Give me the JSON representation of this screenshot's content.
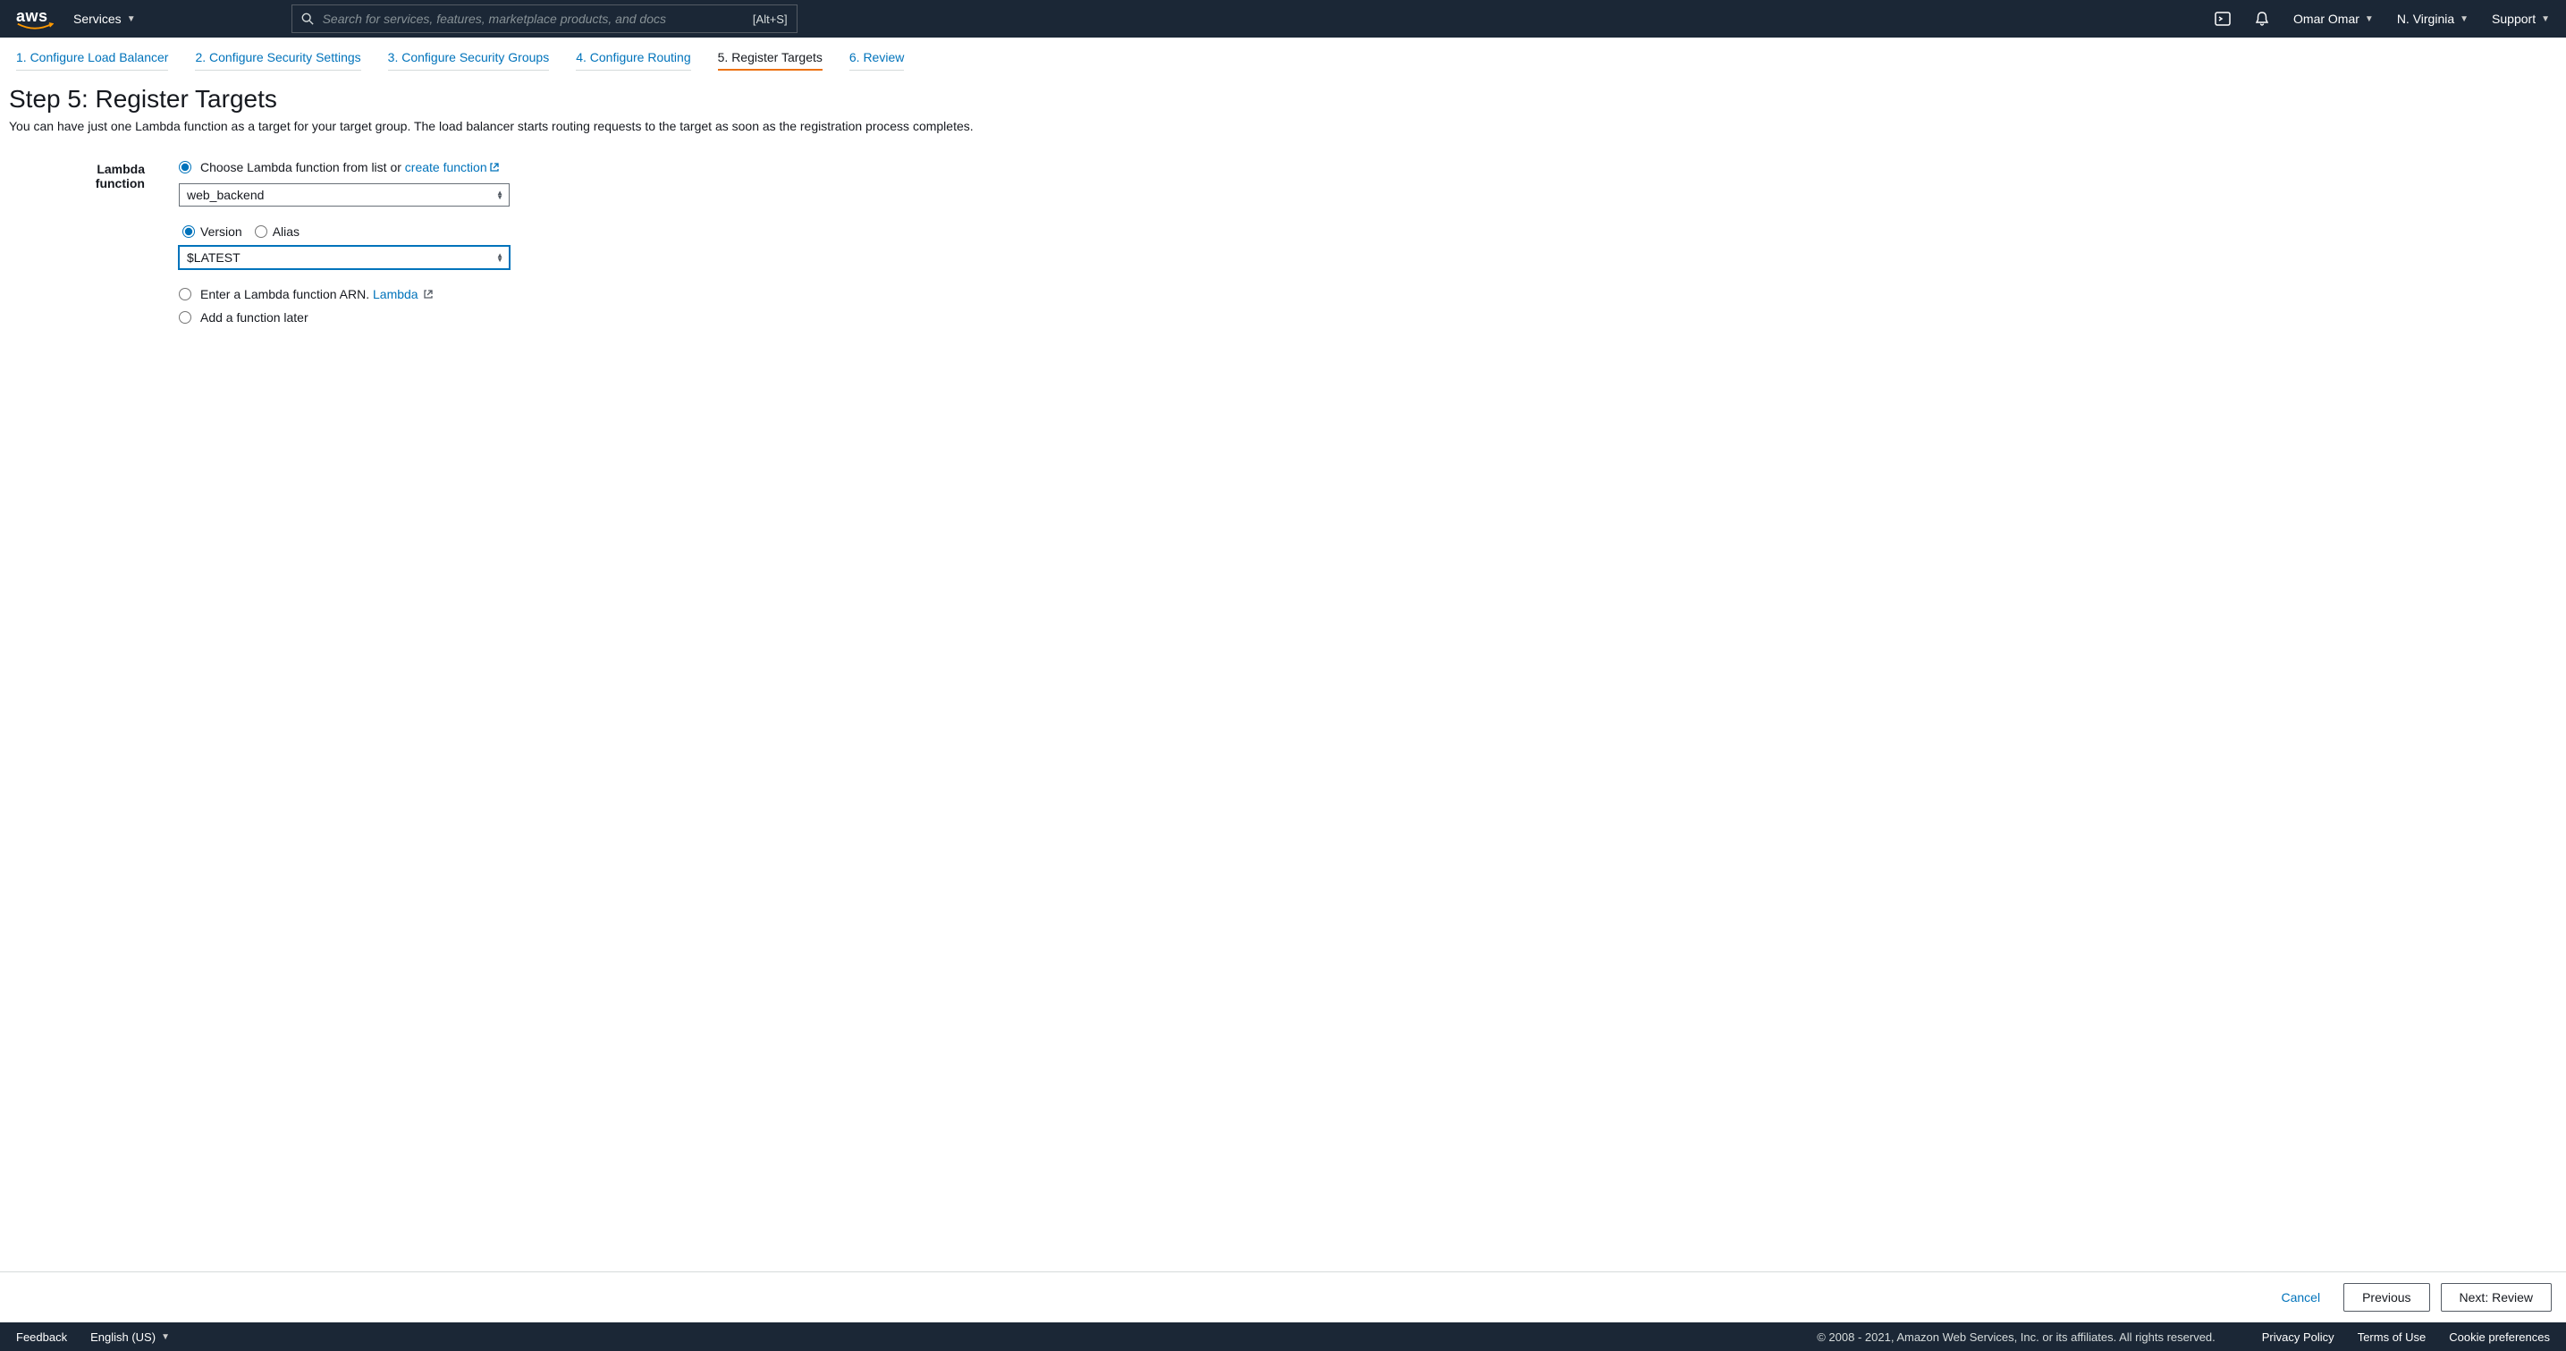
{
  "navbar": {
    "services_label": "Services",
    "search_placeholder": "Search for services, features, marketplace products, and docs",
    "search_shortcut": "[Alt+S]",
    "user": "Omar Omar",
    "region": "N. Virginia",
    "support": "Support"
  },
  "wizard": {
    "steps": [
      "1. Configure Load Balancer",
      "2. Configure Security Settings",
      "3. Configure Security Groups",
      "4. Configure Routing",
      "5. Register Targets",
      "6. Review"
    ],
    "active_index": 4
  },
  "page": {
    "heading": "Step 5: Register Targets",
    "subtitle": "You can have just one Lambda function as a target for your target group. The load balancer starts routing requests to the target as soon as the registration process completes."
  },
  "form": {
    "field_label": "Lambda function",
    "option_choose": {
      "prefix": "Choose Lambda function from list or ",
      "link": "create function",
      "checked": true
    },
    "function_selected": "web_backend",
    "vers_alias": {
      "version_label": "Version",
      "alias_label": "Alias",
      "version_checked": true
    },
    "version_selected": "$LATEST",
    "option_arn": {
      "prefix": "Enter a Lambda function ARN. ",
      "link": "Lambda",
      "checked": false
    },
    "option_later": {
      "label": "Add a function later",
      "checked": false
    }
  },
  "actions": {
    "cancel": "Cancel",
    "previous": "Previous",
    "next": "Next: Review"
  },
  "statusbar": {
    "feedback": "Feedback",
    "language": "English (US)",
    "copyright": "© 2008 - 2021, Amazon Web Services, Inc. or its affiliates. All rights reserved.",
    "links": [
      "Privacy Policy",
      "Terms of Use",
      "Cookie preferences"
    ]
  }
}
